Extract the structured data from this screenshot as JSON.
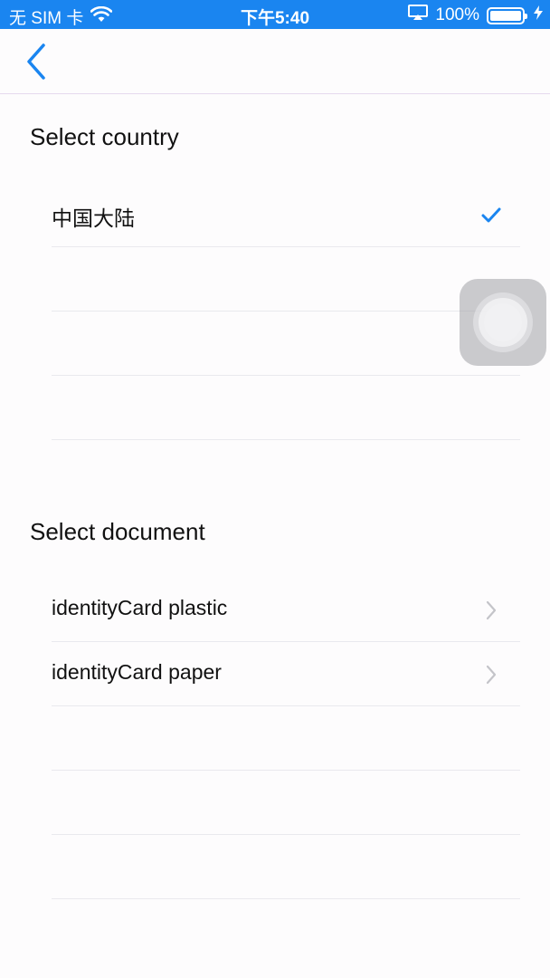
{
  "status_bar": {
    "carrier": "无 SIM 卡",
    "time": "下午5:40",
    "battery_percent": "100%",
    "battery_level": 1.0,
    "wifi_icon": "wifi-icon",
    "airplay_icon": "airplay-icon",
    "charging_icon": "charging-bolt-icon"
  },
  "nav": {
    "back_icon": "chevron-left-icon",
    "accent_color": "#1a85f0"
  },
  "country_section": {
    "title": "Select country",
    "items": [
      {
        "label": "中国大陆",
        "selected": true
      },
      {
        "label": ""
      },
      {
        "label": ""
      },
      {
        "label": ""
      }
    ]
  },
  "document_section": {
    "title": "Select document",
    "items": [
      {
        "label": "identityCard plastic"
      },
      {
        "label": "identityCard paper"
      },
      {
        "label": ""
      },
      {
        "label": ""
      },
      {
        "label": ""
      }
    ]
  }
}
